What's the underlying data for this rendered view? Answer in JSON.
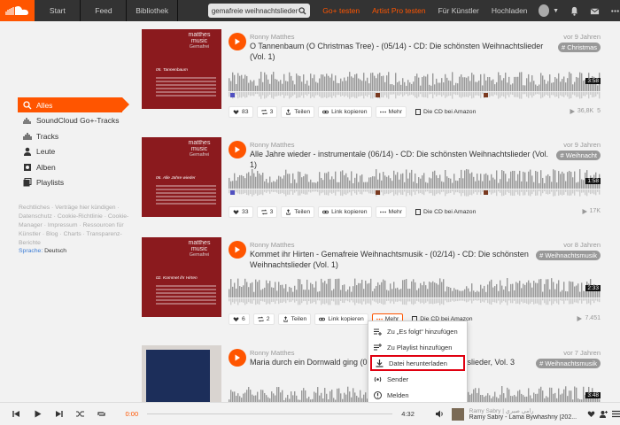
{
  "header": {
    "nav": [
      "Start",
      "Feed",
      "Bibliothek"
    ],
    "search_value": "gemafreie weihnachtslieder",
    "links": [
      "Go+ testen",
      "Artist Pro testen",
      "Für Künstler",
      "Hochladen"
    ],
    "accent": "#ff5500"
  },
  "sidebar": {
    "items": [
      {
        "label": "Alles",
        "icon": "search-icon"
      },
      {
        "label": "SoundCloud Go+-Tracks",
        "icon": "go-plus-icon"
      },
      {
        "label": "Tracks",
        "icon": "waveform-icon"
      },
      {
        "label": "Leute",
        "icon": "user-icon"
      },
      {
        "label": "Alben",
        "icon": "album-icon"
      },
      {
        "label": "Playlists",
        "icon": "playlist-icon"
      }
    ],
    "footer": "Rechtliches · Verträge hier kündigen · Datenschutz · Cookie-Richtlinie · Cookie-Manager · Impressum · Ressourcen für Künstler · Blog · Charts · Transparenz-Berichte",
    "lang_label": "Sprache:",
    "lang_value": "Deutsch"
  },
  "tracks": [
    {
      "artist": "Ronny Matthes",
      "title": "O Tannenbaum (O Christmas Tree) - (05/14) - CD: Die schönsten Weihnachtslieder (Vol. 1)",
      "date": "vor 9 Jahren",
      "tag": "# Christmas",
      "duration": "3:58",
      "likes": "83",
      "reposts": "3",
      "plays": "36,8K",
      "extra": "5",
      "cover_title": "05. Tannenbaum"
    },
    {
      "artist": "Ronny Matthes",
      "title": "Alle Jahre wieder - instrumentale (06/14) - CD: Die schönsten Weihnachtslieder (Vol. 1)",
      "date": "vor 9 Jahren",
      "tag": "# Weihnacht",
      "duration": "1:58",
      "likes": "33",
      "reposts": "3",
      "plays": "17K",
      "extra": "",
      "cover_title": "06. Alle Jahre wieder"
    },
    {
      "artist": "Ronny Matthes",
      "title": "Kommet ihr Hirten - Gemafreie Weihnachtsmusik - (02/14) - CD: Die schönsten Weihnachtslieder (Vol. 1)",
      "date": "vor 8 Jahren",
      "tag": "# Weihnachtsmusik",
      "duration": "2:33",
      "likes": "6",
      "reposts": "2",
      "plays": "7.451",
      "extra": "",
      "cover_title": "02. Kommet ihr Hirten"
    },
    {
      "artist": "Ronny Matthes",
      "title": "Maria durch ein Dornwald ging (03 ... ie schönsten Weihnachtslieder, Vol. 3",
      "date": "vor 7 Jahren",
      "tag": "# Weihnachtsmusik",
      "duration": "3:48"
    }
  ],
  "cover_brand": {
    "line1": "matthes",
    "line2": "music",
    "line3": "Gemafrei"
  },
  "actions": {
    "share": "Teilen",
    "copy_link": "Link kopieren",
    "more": "Mehr",
    "amazon": "Die CD bei Amazon"
  },
  "dropdown": {
    "items": [
      {
        "label": "Zu „Es folgt“ hinzufügen",
        "icon": "next-up-icon"
      },
      {
        "label": "Zu Playlist hinzufügen",
        "icon": "add-playlist-icon"
      },
      {
        "label": "Datei herunterladen",
        "icon": "download-icon",
        "highlighted": true
      },
      {
        "label": "Sender",
        "icon": "station-icon"
      },
      {
        "label": "Melden",
        "icon": "report-icon"
      }
    ]
  },
  "player": {
    "current_time": "0:00",
    "total_time": "4:32",
    "artist": "Ramy Sabry | رامي صبري",
    "title": "Ramy Sabry - Lama Bywhashny [202..."
  }
}
